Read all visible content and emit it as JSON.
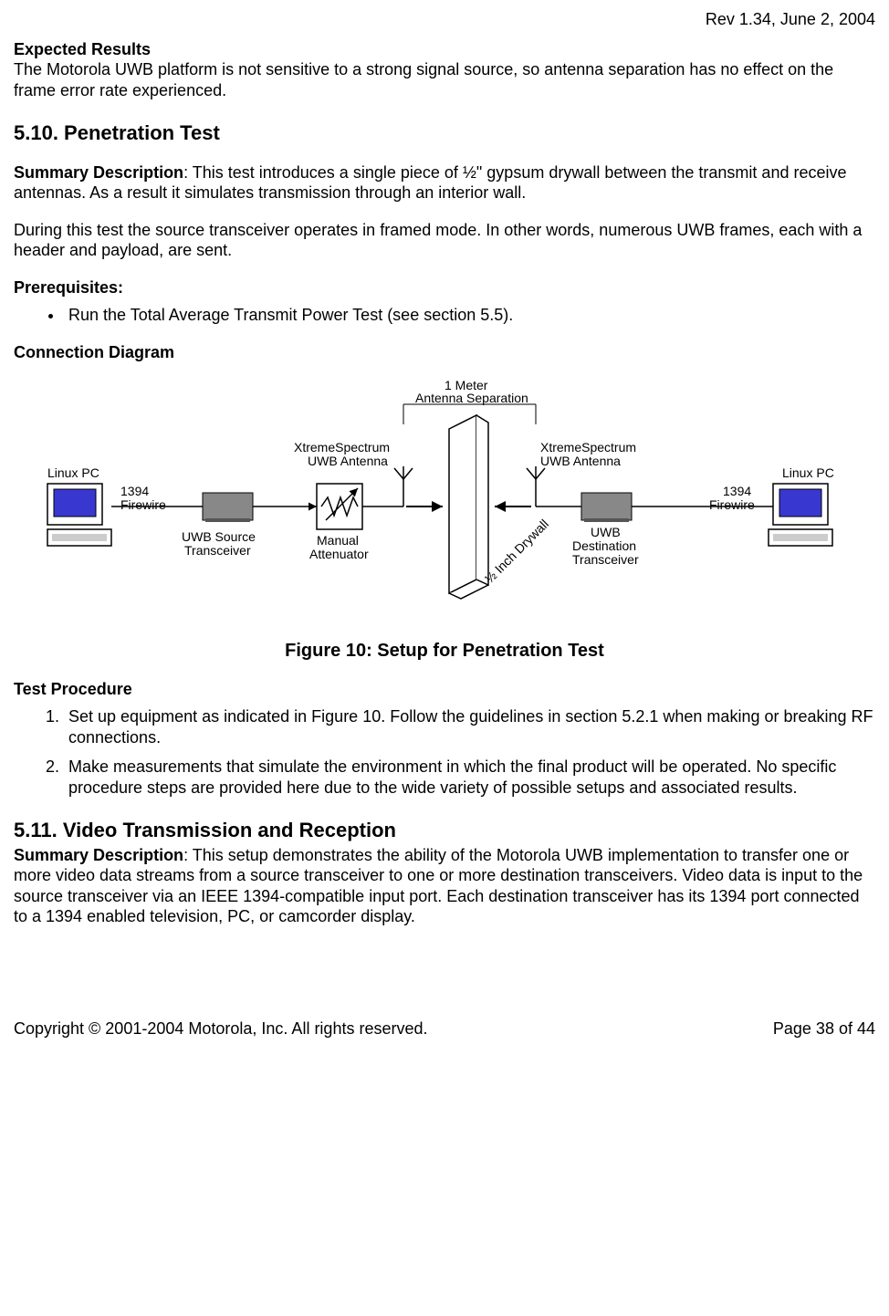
{
  "header": {
    "rev": "Rev 1.34, June 2, 2004"
  },
  "sec_a": {
    "title": "Expected Results",
    "text": "The Motorola UWB platform is not sensitive to a strong signal source, so antenna separation has no effect on the frame error rate experienced."
  },
  "sec_b": {
    "heading": "5.10. Penetration Test",
    "summary_label": "Summary Description",
    "summary_text": ": This test introduces a single piece of ½\" gypsum drywall between the transmit and receive antennas. As a result it simulates transmission through an interior wall.",
    "para2": "During this test the source transceiver operates in framed mode. In other words, numerous UWB frames, each with a header and payload, are sent.",
    "prereq_label": "Prerequisites:",
    "prereq_item": "Run the Total Average Transmit Power Test (see section 5.5).",
    "conn_label": "Connection Diagram",
    "figure_caption": "Figure 10: Setup for Penetration Test",
    "proc_label": "Test Procedure",
    "step1": "Set up equipment as indicated in Figure 10. Follow the guidelines in section 5.2.1 when making or breaking RF connections.",
    "step2": "Make measurements that simulate the environment in which the final product will be operated. No specific procedure steps are provided here due to the wide variety of possible setups and associated results."
  },
  "diagram": {
    "linux_pc": "Linux PC",
    "firewire": "1394\nFirewire",
    "source": "UWB Source\nTransceiver",
    "attenuator": "Manual\nAttenuator",
    "antenna_l": "XtremeSpectrum\nUWB Antenna",
    "antenna_r": "XtremeSpectrum\nUWB Antenna",
    "sep1": "1 Meter",
    "sep2": "Antenna Separation",
    "drywall": "½ Inch Drywall",
    "dest": "UWB\nDestination\nTransceiver"
  },
  "sec_c": {
    "heading": "5.11. Video Transmission and Reception",
    "summary_label": "Summary Description",
    "summary_text": ": This setup demonstrates the ability of the Motorola UWB implementation to transfer one or more video data streams from a source transceiver to one or more destination transceivers. Video data is input to the source transceiver via an IEEE 1394-compatible input port. Each destination transceiver has its 1394 port connected to a 1394 enabled television, PC, or camcorder display."
  },
  "footer": {
    "copyright": "Copyright © 2001-2004 Motorola, Inc. All rights reserved.",
    "page": "Page 38 of 44"
  }
}
